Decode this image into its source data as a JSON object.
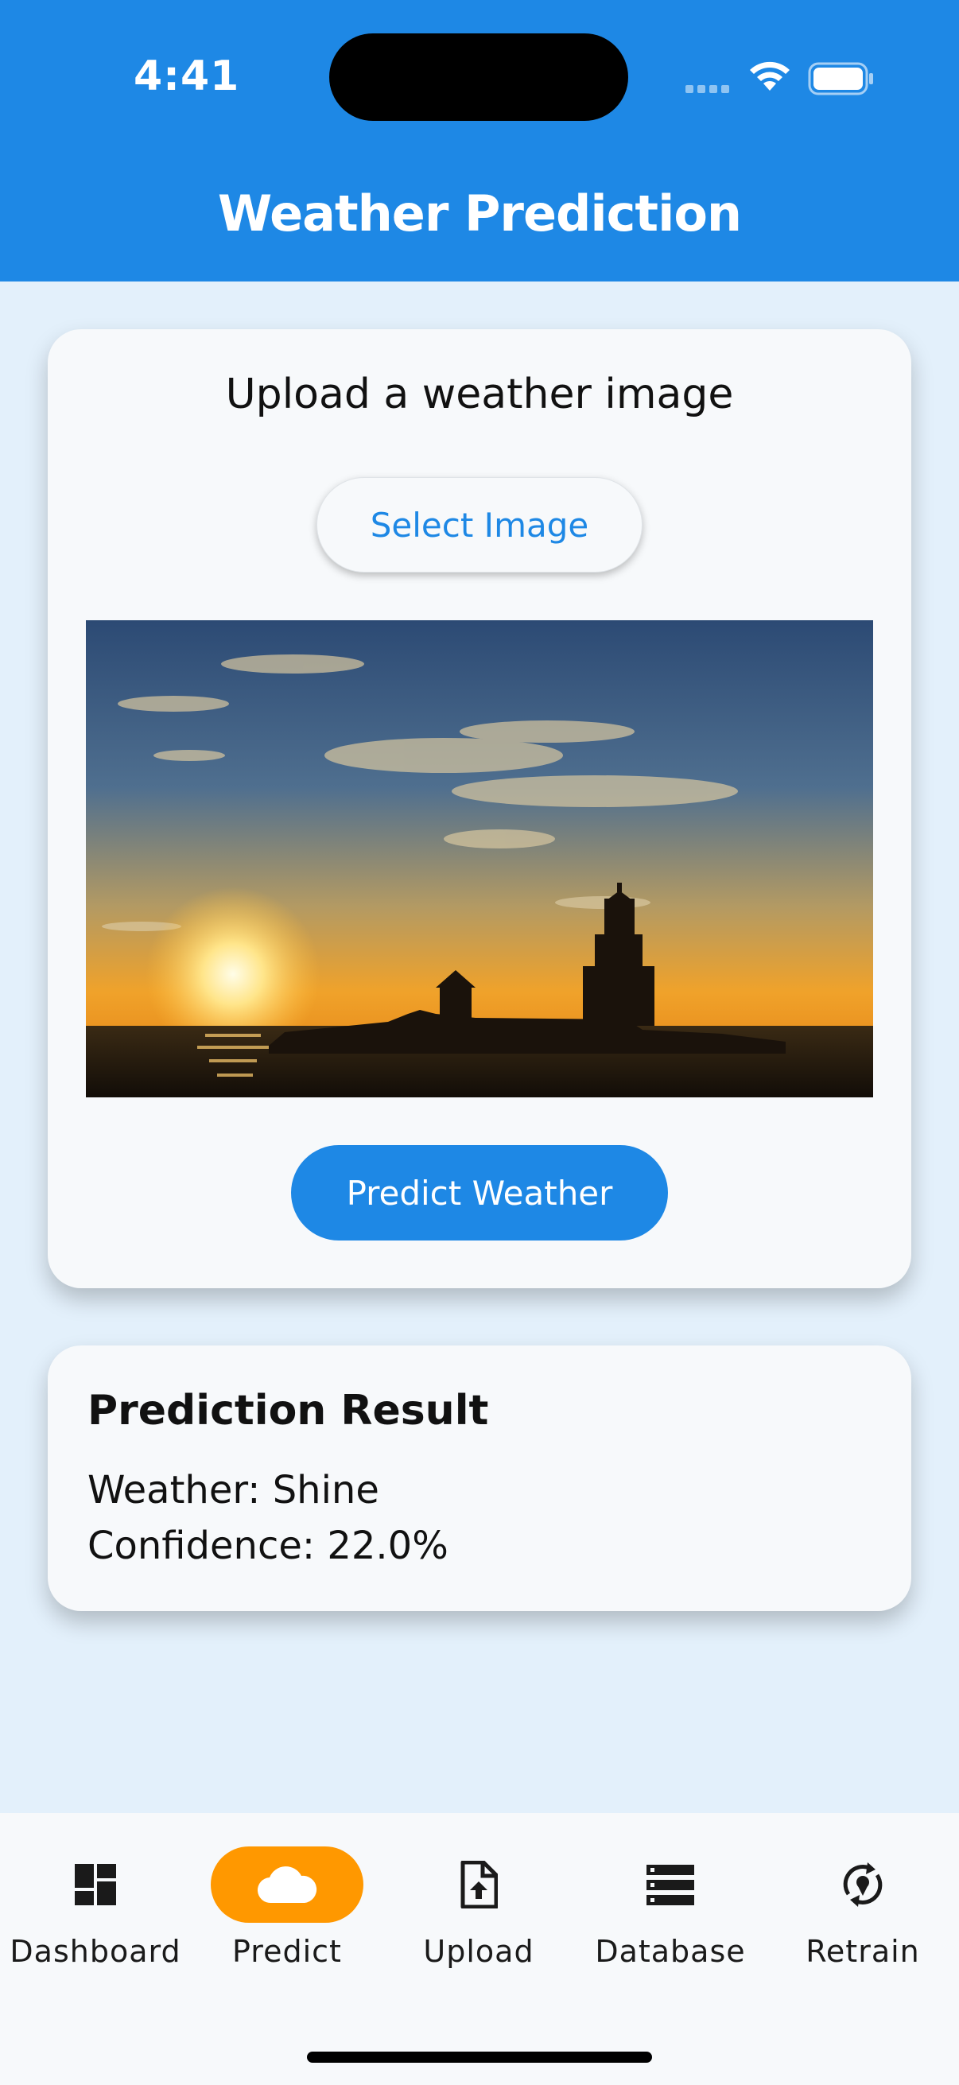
{
  "status_bar": {
    "time": "4:41"
  },
  "app_bar": {
    "title": "Weather Prediction"
  },
  "upload_card": {
    "heading": "Upload a weather image",
    "select_button": "Select Image",
    "predict_button": "Predict Weather"
  },
  "result_card": {
    "title": "Prediction Result",
    "weather_line": "Weather: Shine",
    "confidence_line": "Confidence: 22.0%"
  },
  "bottom_nav": {
    "items": [
      {
        "label": "Dashboard",
        "icon": "dashboard-icon",
        "active": false
      },
      {
        "label": "Predict",
        "icon": "cloud-icon",
        "active": true
      },
      {
        "label": "Upload",
        "icon": "file-upload-icon",
        "active": false
      },
      {
        "label": "Database",
        "icon": "storage-icon",
        "active": false
      },
      {
        "label": "Retrain",
        "icon": "retrain-icon",
        "active": false
      }
    ]
  },
  "colors": {
    "primary": "#1e88e5",
    "accent": "#ff9800",
    "background": "#e3f0fb",
    "card": "#f7f9fb"
  }
}
